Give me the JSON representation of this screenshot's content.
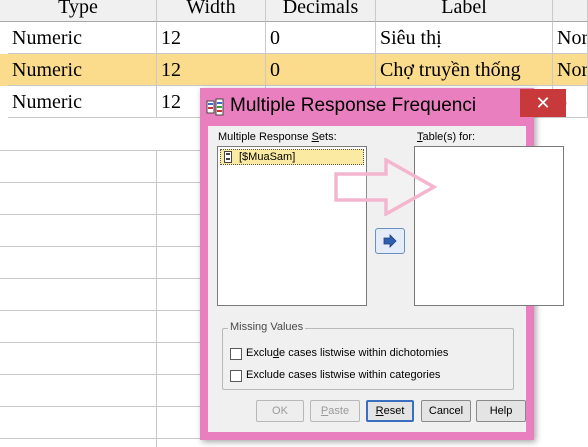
{
  "grid": {
    "headers": [
      "Type",
      "Width",
      "Decimals",
      "Label",
      ""
    ],
    "rows": [
      {
        "type": "Numeric",
        "width": "12",
        "decimals": "0",
        "label": "Siêu thị",
        "extra": "Nor"
      },
      {
        "type": "Numeric",
        "width": "12",
        "decimals": "0",
        "label": "Chợ truyền thống",
        "extra": "Nor"
      },
      {
        "type": "Numeric",
        "width": "12",
        "decimals": "",
        "label": "",
        "extra": "o"
      }
    ]
  },
  "dialog": {
    "title": "Multiple Response Frequenci",
    "close_glyph": "✕",
    "sets_label_prefix": "Multiple Response ",
    "sets_label_mnemonic": "S",
    "sets_label_suffix": "ets:",
    "sets_items": [
      "[$MuaSam]"
    ],
    "tables_label_mnemonic": "T",
    "tables_label_suffix": "able(s) for:",
    "missing_values_legend": "Missing Values",
    "opt1_prefix": "Exclu",
    "opt1_mnemonic": "d",
    "opt1_suffix": "e cases listwise within dichotomies",
    "opt2_prefix": "Exclude cases listwise within cate",
    "opt2_mnemonic": "g",
    "opt2_suffix": "ories",
    "buttons": {
      "ok": "OK",
      "paste_mnemonic": "P",
      "paste_suffix": "aste",
      "reset_mnemonic": "R",
      "reset_suffix": "eset",
      "cancel": "Cancel",
      "help": "Help"
    }
  },
  "colors": {
    "dialog_frame": "#e97fbf",
    "selected_row": "#fbdc8c",
    "close_button": "#c7393a",
    "arrow_overlay": "#f4b6cf"
  },
  "icons": {
    "dialog": "dialog-app-icon",
    "set_item": "response-set-icon",
    "move": "move-right-arrow-icon",
    "annotation": "annotation-arrow-icon"
  }
}
